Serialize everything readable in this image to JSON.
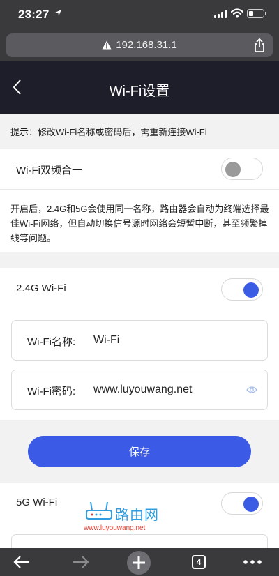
{
  "status_bar": {
    "time": "23:27"
  },
  "browser": {
    "url": "192.168.31.1",
    "tab_count": "4"
  },
  "header": {
    "title": "Wi-Fi设置"
  },
  "tip": "提示：修改Wi-Fi名称或密码后，需重新连接Wi-Fi",
  "dual_band": {
    "label": "Wi-Fi双频合一",
    "enabled": false,
    "description": "开启后，2.4G和5G会使用同一名称，路由器会自动为终端选择最佳Wi-Fi网络，但自动切换信号源时网络会短暂中断，甚至频繁掉线等问题。"
  },
  "wifi_24g": {
    "label": "2.4G Wi-Fi",
    "enabled": true,
    "name_label": "Wi-Fi名称:",
    "name_value": "Wi-Fi",
    "password_label": "Wi-Fi密码:",
    "password_value": "www.luyouwang.net"
  },
  "save_label": "保存",
  "wifi_5g": {
    "label": "5G Wi-Fi",
    "enabled": true
  },
  "watermark": {
    "text": "路由网",
    "url": "www.luyouwang.net"
  },
  "colors": {
    "accent": "#3b5ae6",
    "header_bg": "#1e1e2a",
    "browser_chrome": "#3a3a3c"
  }
}
